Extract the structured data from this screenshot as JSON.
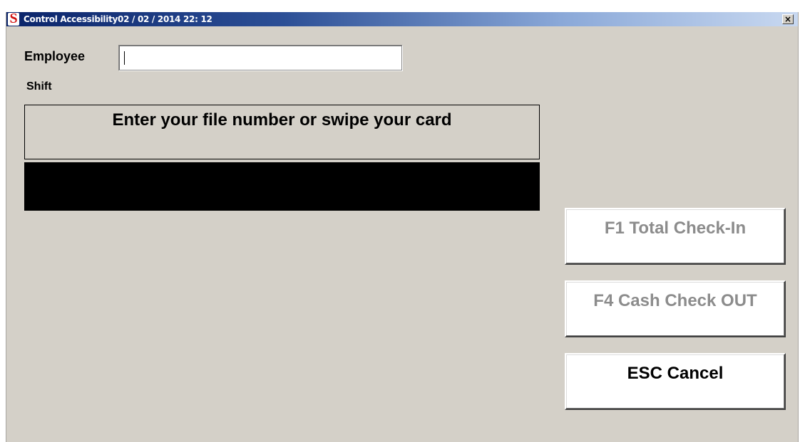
{
  "window": {
    "title": "Control Accessibility02 / 02 / 2014 22: 12",
    "icon": "dollar-s-icon",
    "icon_glyph": "S",
    "close_glyph": "×"
  },
  "form": {
    "employee_label": "Employee",
    "employee_value": "",
    "shift_label": "Shift"
  },
  "message": {
    "text": "Enter your file number or swipe your card"
  },
  "buttons": {
    "f1_label": "F1  Total Check-In",
    "f4_label": "F4 Cash Check OUT",
    "esc_label": "ESC Cancel"
  },
  "colors": {
    "window_bg": "#d4d0c8",
    "titlebar_start": "#0a246a",
    "titlebar_end": "#c8d8f0",
    "disabled_text": "#8c8c8c",
    "icon_red": "#d01010"
  }
}
